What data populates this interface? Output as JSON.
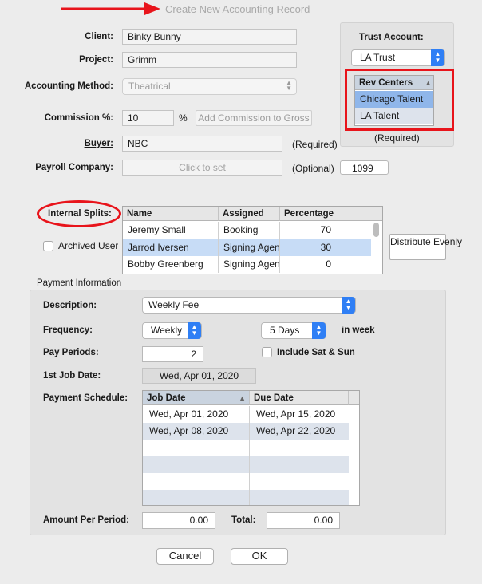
{
  "window": {
    "title": "Create New Accounting Record"
  },
  "form": {
    "client_label": "Client:",
    "client_value": "Binky Bunny",
    "project_label": "Project:",
    "project_value": "Grimm",
    "method_label": "Accounting Method:",
    "method_value": "Theatrical",
    "commission_label": "Commission %:",
    "commission_value": "10",
    "percent_sign": "%",
    "add_commission_button": "Add Commission to Gross",
    "buyer_label": "Buyer:",
    "buyer_value": "NBC",
    "buyer_note": "(Required)",
    "payroll_label": "Payroll Company:",
    "payroll_placeholder": "Click to set",
    "payroll_note": "(Optional)",
    "tax_form_value": "1099"
  },
  "trust": {
    "label": "Trust Account:",
    "value": "LA Trust",
    "rev_header": "Rev Centers",
    "rev_items": [
      "Chicago Talent",
      "LA Talent"
    ],
    "note": "(Required)"
  },
  "splits": {
    "label": "Internal Splits:",
    "archived_label": "Archived Users",
    "distribute_button": "Distribute Evenly",
    "columns": [
      "Name",
      "Assigned",
      "Percentage"
    ],
    "rows": [
      {
        "name": "Jeremy Small",
        "assigned": "Booking",
        "percentage": "70"
      },
      {
        "name": "Jarrod Iversen",
        "assigned": "Signing Agent",
        "percentage": "30"
      },
      {
        "name": "Bobby Greenberg",
        "assigned": "Signing Agent",
        "percentage": "0"
      }
    ]
  },
  "payment": {
    "section_label": "Payment Information",
    "description_label": "Description:",
    "description_value": "Weekly Fee",
    "frequency_label": "Frequency:",
    "frequency_value": "Weekly",
    "days_value": "5 Days",
    "in_week_label": "in week",
    "periods_label": "Pay Periods:",
    "periods_value": "2",
    "include_label": "Include Sat & Sun",
    "first_date_label": "1st Job Date:",
    "first_date_value": "Wed, Apr 01, 2020",
    "schedule_label": "Payment Schedule:",
    "schedule_columns": [
      "Job Date",
      "Due Date"
    ],
    "schedule_rows": [
      {
        "job": "Wed, Apr 01, 2020",
        "due": "Wed, Apr 15, 2020"
      },
      {
        "job": "Wed, Apr 08, 2020",
        "due": "Wed, Apr 22, 2020"
      }
    ],
    "amount_label": "Amount Per Period:",
    "amount_value": "0.00",
    "total_label": "Total:",
    "total_value": "0.00"
  },
  "footer": {
    "cancel": "Cancel",
    "ok": "OK"
  },
  "colors": {
    "annotation": "#e8141b",
    "accent": "#2f7ff5",
    "selection": "#c7dcf6"
  }
}
